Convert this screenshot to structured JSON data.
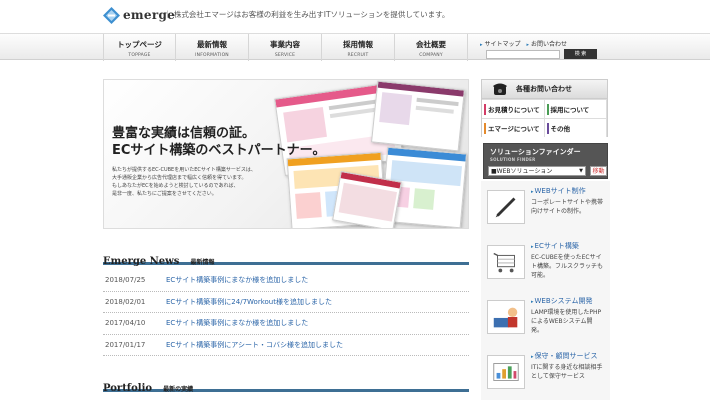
{
  "header": {
    "logo_text": "emerge",
    "tagline": "｜ 株式会社エマージはお客様の利益を生み出すITソリューションを提供しています。"
  },
  "nav": [
    {
      "jp": "トップページ",
      "en": "TOPPAGE"
    },
    {
      "jp": "最新情報",
      "en": "INFORMATION"
    },
    {
      "jp": "事業内容",
      "en": "SERVICE"
    },
    {
      "jp": "採用情報",
      "en": "RECRUIT"
    },
    {
      "jp": "会社概要",
      "en": "COMPANY"
    }
  ],
  "utility": {
    "sitemap": "サイトマップ",
    "contact": "お問い合わせ",
    "search_value": "",
    "search_button": "検 索"
  },
  "hero": {
    "title_line1": "豊富な実績は信頼の証。",
    "title_line2": "ECサイト構築のベストパートナー。",
    "desc_line1": "私たちが提供するEC-CUBEを用いたECサイト構築サービスは、",
    "desc_line2": "大手通販企業から広告代理店まで幅広く信頼を得ています。",
    "desc_line3": "もしあなたがECを始めようと検討しているのであれば、",
    "desc_line4": "是非一度、私たちにご提案をさせてください。"
  },
  "news": {
    "heading_en": "Emerge News",
    "heading_jp": "最新情報",
    "items": [
      {
        "date": "2018/07/25",
        "text": "ECサイト構築事例にまなか様を追加しました"
      },
      {
        "date": "2018/02/01",
        "text": "ECサイト構築事例に24/7Workout様を追加しました"
      },
      {
        "date": "2017/04/10",
        "text": "ECサイト構築事例にまなか様を追加しました"
      },
      {
        "date": "2017/01/17",
        "text": "ECサイト構築事例にアシート・コバシ様を追加しました"
      }
    ]
  },
  "portfolio": {
    "heading_en": "Portfolio",
    "heading_jp": "最新の実績"
  },
  "contact": {
    "title": "各種お問い合わせ",
    "items": [
      "お見積りについて",
      "採用について",
      "エマージについて",
      "その他"
    ]
  },
  "finder": {
    "title": "ソリューションファインダー",
    "subtitle": "SOLUTION FINDER",
    "selected": "■WEBソリューション",
    "go_button": "移動"
  },
  "services": [
    {
      "title": "WEBサイト制作",
      "desc": "コーポレートサイトや携帯向けサイトの制作。"
    },
    {
      "title": "ECサイト構築",
      "desc": "EC-CUBEを使ったECサイト構築。フルスクラッチも可能。"
    },
    {
      "title": "WEBシステム開発",
      "desc": "LAMP環境を使用したPHPによるWEBシステム開発。"
    },
    {
      "title": "保守・顧問サービス",
      "desc": "ITに関する身近な相談相手として保守サービス"
    }
  ]
}
